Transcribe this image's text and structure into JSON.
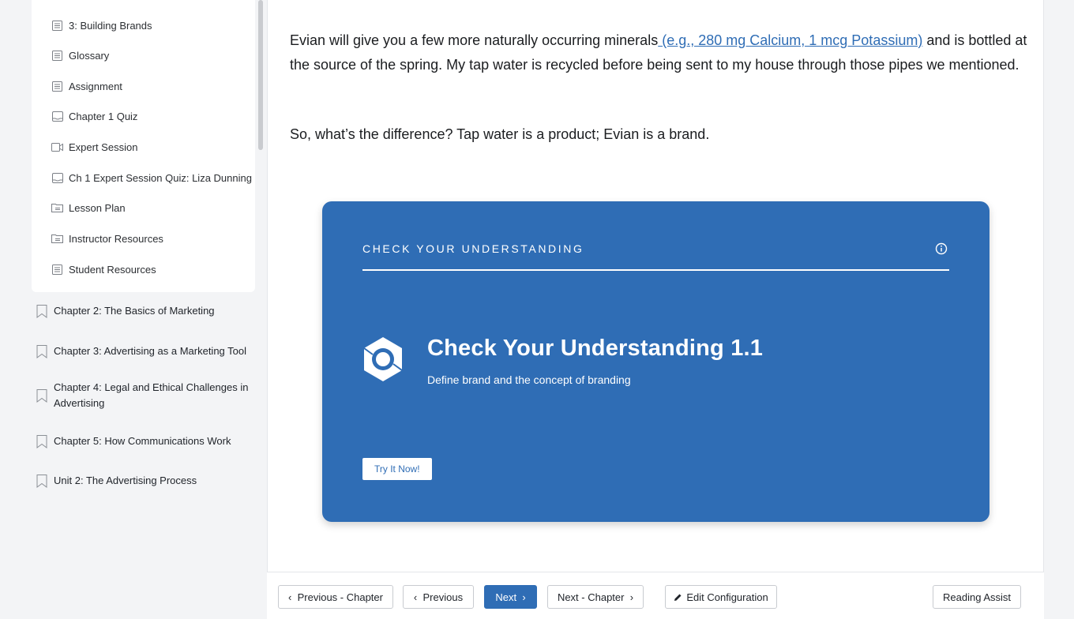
{
  "sidebar": {
    "sub_items": [
      {
        "label": "3: Building Brands",
        "icon": "page-icon"
      },
      {
        "label": "Glossary",
        "icon": "page-icon"
      },
      {
        "label": "Assignment",
        "icon": "page-icon"
      },
      {
        "label": "Chapter 1 Quiz",
        "icon": "quiz-icon"
      },
      {
        "label": "Expert Session",
        "icon": "video-icon"
      },
      {
        "label": "Ch 1 Expert Session Quiz: Liza Dunning",
        "icon": "quiz-icon"
      },
      {
        "label": "Lesson Plan",
        "icon": "folder-icon"
      },
      {
        "label": "Instructor Resources",
        "icon": "folder-icon"
      },
      {
        "label": "Student Resources",
        "icon": "page-icon"
      }
    ],
    "chapters": [
      {
        "label": "Chapter 2: The Basics of Marketing",
        "icon": "bookmark-icon"
      },
      {
        "label": "Chapter 3: Advertising as a Marketing Tool",
        "icon": "bookmark-icon"
      },
      {
        "label": "Chapter 4: Legal and Ethical Challenges in Advertising",
        "icon": "bookmark-icon"
      },
      {
        "label": "Chapter 5: How Communications Work",
        "icon": "bookmark-icon"
      },
      {
        "label": "Unit 2: The Advertising Process",
        "icon": "bookmark-icon"
      }
    ]
  },
  "content": {
    "para1_before": "Evian will give you a few more naturally occurring minerals",
    "para1_link": " (e.g., 280 mg Calcium, 1 mcg Potassium)",
    "para1_after": " and is bottled at the source of the spring. My tap water is recycled before being sent to my house through those pipes we mentioned.",
    "para2": "So, what’s the difference? Tap water is a product; Evian is a brand."
  },
  "check_card": {
    "heading": "CHECK YOUR UNDERSTANDING",
    "title": "Check Your Understanding 1.1",
    "subtitle": "Define brand and the concept of branding",
    "button": "Try It Now!",
    "info_icon": "info-icon",
    "logo_icon": "hexagon-logo-icon"
  },
  "toolbar": {
    "prev_chapter": "Previous - Chapter",
    "previous": "Previous",
    "next": "Next",
    "next_chapter": "Next - Chapter",
    "edit_config": "Edit Configuration",
    "reading_assist": "Reading Assist"
  },
  "colors": {
    "accent": "#2f6db5",
    "link": "#2f6db5",
    "background": "#f3f4f6"
  }
}
